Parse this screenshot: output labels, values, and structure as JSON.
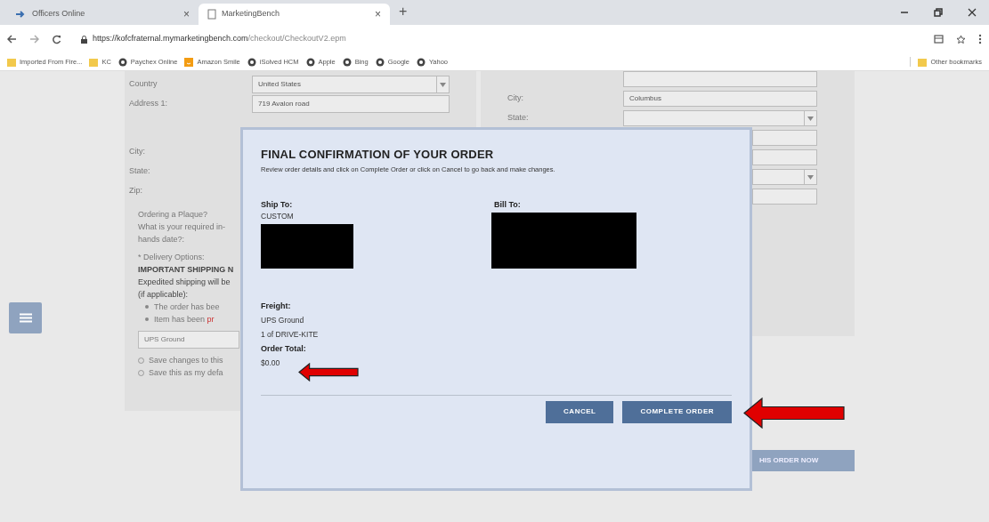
{
  "browser": {
    "tabs": [
      {
        "title": "Officers Online",
        "selected": false,
        "close": "×"
      },
      {
        "title": "MarketingBench",
        "selected": true,
        "close": "×"
      }
    ],
    "new_tab": "+",
    "address": {
      "host": "https://kofcfraternal.mymarketingbench.com",
      "path": "/checkout/CheckoutV2.epm"
    },
    "bookmarks": [
      {
        "title": "Imported From Fire...",
        "kind": "folder"
      },
      {
        "title": "KC",
        "kind": "folder"
      },
      {
        "title": "Paychex Online",
        "kind": "site"
      },
      {
        "title": "Amazon Smile",
        "kind": "shop"
      },
      {
        "title": "iSolved HCM",
        "kind": "site"
      },
      {
        "title": "Apple",
        "kind": "site"
      },
      {
        "title": "Bing",
        "kind": "site"
      },
      {
        "title": "Google",
        "kind": "site"
      },
      {
        "title": "Yahoo",
        "kind": "site"
      }
    ],
    "other_bookmarks": "Other bookmarks"
  },
  "left_form": {
    "fields": [
      {
        "label": "Country",
        "value": "United States",
        "kind": "select"
      },
      {
        "label": "Address 1:",
        "value": "719 Avalon road",
        "kind": "text"
      },
      {
        "label": "City:"
      },
      {
        "label": "State:"
      },
      {
        "label": "Zip:"
      }
    ],
    "plaque_lines": [
      "Ordering a Plaque?",
      "What is your required in-",
      "hands date?:"
    ],
    "delivery_lines": [
      "* Delivery Options:",
      "IMPORTANT SHIPPING N",
      "Expedited shipping will be",
      "(if applicable):"
    ],
    "bullets": [
      "The order has bee",
      "Item has been "
    ],
    "bullet_highlight": "pr",
    "shipping_select": "UPS Ground",
    "options": [
      "Save changes to this",
      "Save this as my defa"
    ]
  },
  "right_form": {
    "fields": [
      {
        "kind": "text"
      },
      {
        "label": "City:",
        "value": "Columbus",
        "kind": "text"
      },
      {
        "label": "State:",
        "kind": "select"
      },
      {
        "kind": "text"
      },
      {
        "kind": "text"
      },
      {
        "kind": "select"
      },
      {
        "kind": "text"
      }
    ],
    "submit_button": "HIS ORDER NOW"
  },
  "modal": {
    "title": "FINAL CONFIRMATION OF YOUR ORDER",
    "subtitle": "Review order details and click on Complete Order or click on Cancel to go back and make changes.",
    "ship_to": {
      "label": "Ship To:",
      "lines": [
        "CUSTOM"
      ]
    },
    "bill_to": {
      "label": "Bill To:"
    },
    "freight": {
      "label": "Freight:",
      "lines": [
        "UPS Ground",
        "1 of DRIVE-KITE"
      ]
    },
    "total": {
      "label": "Order Total:",
      "value": "$0.00"
    },
    "buttons": [
      {
        "label": "CANCEL"
      },
      {
        "label": "COMPLETE ORDER"
      }
    ]
  }
}
